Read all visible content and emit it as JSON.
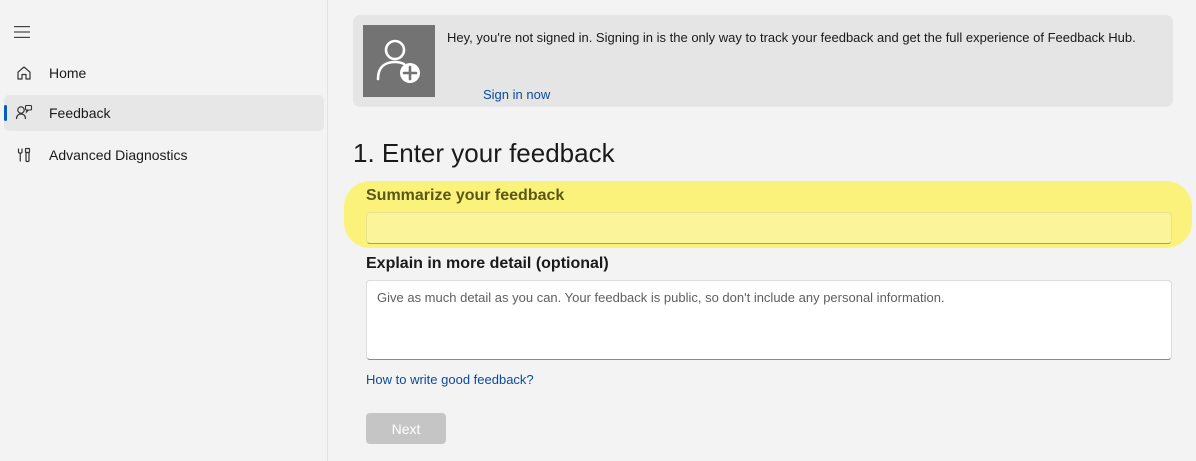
{
  "sidebar": {
    "menu_icon": "hamburger-menu-icon",
    "items": [
      {
        "label": "Home",
        "icon": "home-icon",
        "selected": false
      },
      {
        "label": "Feedback",
        "icon": "feedback-icon",
        "selected": true
      },
      {
        "label": "Advanced Diagnostics",
        "icon": "diagnostics-icon",
        "selected": false
      }
    ]
  },
  "banner": {
    "icon": "add-person-icon",
    "message": "Hey, you're not signed in. Signing in is the only way to track your feedback and get the full experience of Feedback Hub.",
    "sign_in_link": "Sign in now"
  },
  "form": {
    "section_title": "1. Enter your feedback",
    "summary_label": "Summarize your feedback",
    "summary_value": "",
    "detail_label": "Explain in more detail (optional)",
    "detail_placeholder": "Give as much detail as you can. Your feedback is public, so don't include any personal information.",
    "detail_value": "",
    "help_link": "How to write good feedback?",
    "next_label": "Next",
    "next_enabled": false
  },
  "colors": {
    "accent": "#005fb8",
    "link": "#0a4a9c",
    "highlight": "#faf27a",
    "avatar_bg": "#737373",
    "disabled_button": "#c5c5c5"
  }
}
